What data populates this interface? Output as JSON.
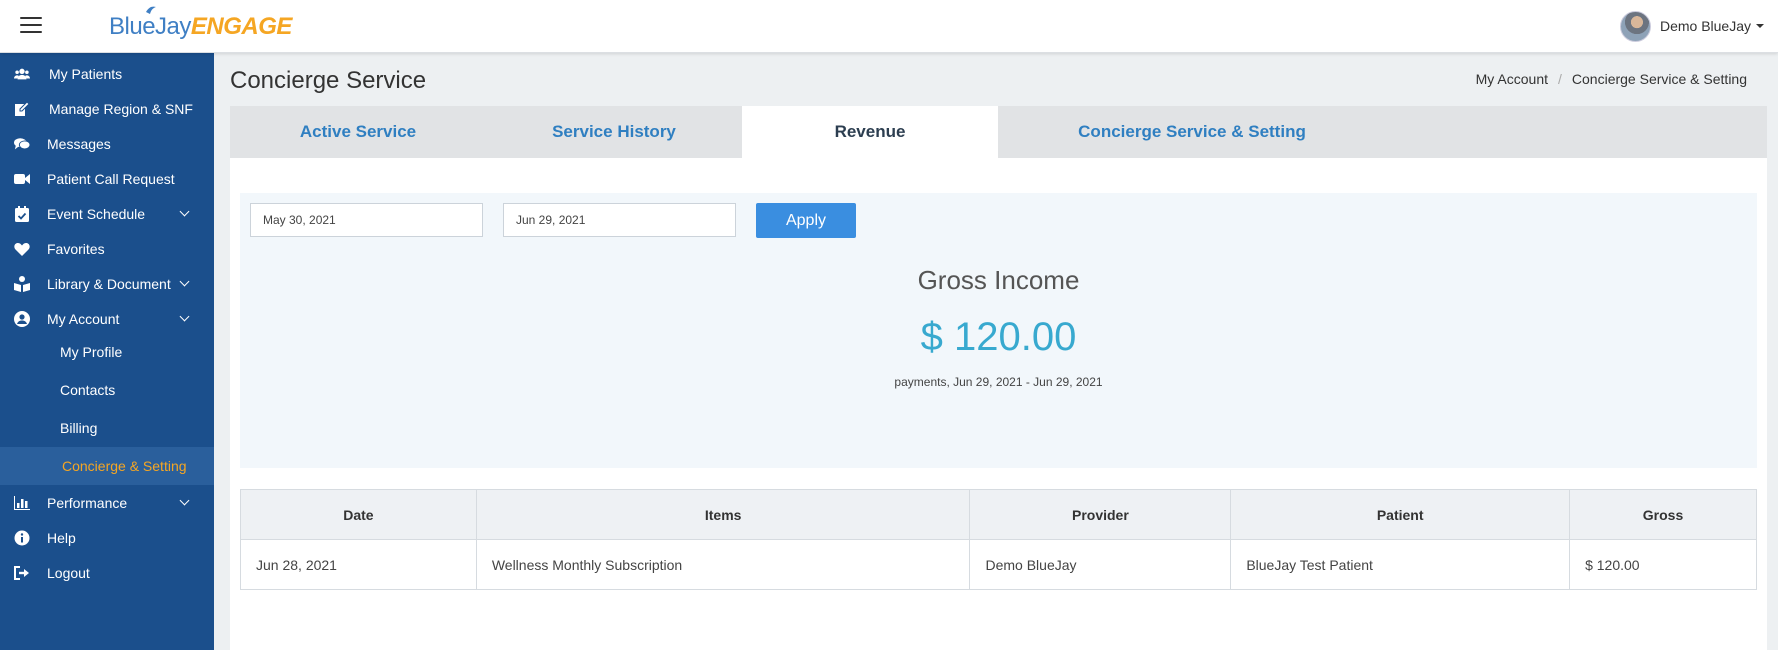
{
  "header": {
    "logo_blue": "BlueJay",
    "logo_orange": "ENGAGE",
    "user_name": "Demo BlueJay"
  },
  "sidebar": {
    "items": [
      {
        "label": "My Patients",
        "icon": "users-icon"
      },
      {
        "label": "Manage Region & SNF",
        "icon": "edit-icon"
      },
      {
        "label": "Messages",
        "icon": "comments-icon"
      },
      {
        "label": "Patient Call Request",
        "icon": "video-icon"
      },
      {
        "label": "Event Schedule",
        "icon": "calendar-check-icon"
      },
      {
        "label": "Favorites",
        "icon": "heart-icon"
      },
      {
        "label": "Library & Document",
        "icon": "book-reader-icon"
      },
      {
        "label": "My Account",
        "icon": "user-circle-icon"
      },
      {
        "label": "Performance",
        "icon": "bar-chart-icon"
      },
      {
        "label": "Help",
        "icon": "info-circle-icon"
      },
      {
        "label": "Logout",
        "icon": "sign-out-icon"
      }
    ],
    "account_sub": [
      {
        "label": "My Profile"
      },
      {
        "label": "Contacts"
      },
      {
        "label": "Billing"
      },
      {
        "label": "Concierge & Setting"
      }
    ],
    "active_color": "#f5a623"
  },
  "page": {
    "title": "Concierge Service",
    "breadcrumb": [
      "My Account",
      "Concierge Service & Setting"
    ]
  },
  "tabs": [
    {
      "label": "Active Service"
    },
    {
      "label": "Service History"
    },
    {
      "label": "Revenue"
    },
    {
      "label": "Concierge Service & Setting"
    }
  ],
  "active_tab": "Revenue",
  "filter": {
    "start_date": "May 30, 2021",
    "end_date": "Jun 29, 2021",
    "apply_label": "Apply"
  },
  "summary": {
    "title": "Gross Income",
    "amount": "$ 120.00",
    "caption": "payments, Jun 29, 2021 - Jun 29, 2021",
    "amount_color": "#38a9cf"
  },
  "table": {
    "headers": [
      "Date",
      "Items",
      "Provider",
      "Patient",
      "Gross"
    ],
    "rows": [
      [
        "Jun 28, 2021",
        "Wellness Monthly Subscription",
        "Demo BlueJay",
        "BlueJay Test Patient",
        "$ 120.00"
      ]
    ]
  },
  "colors": {
    "sidebar_bg": "#1b4f8c",
    "tab_link": "#2f7fc1",
    "apply_button": "#3a8ee0"
  }
}
